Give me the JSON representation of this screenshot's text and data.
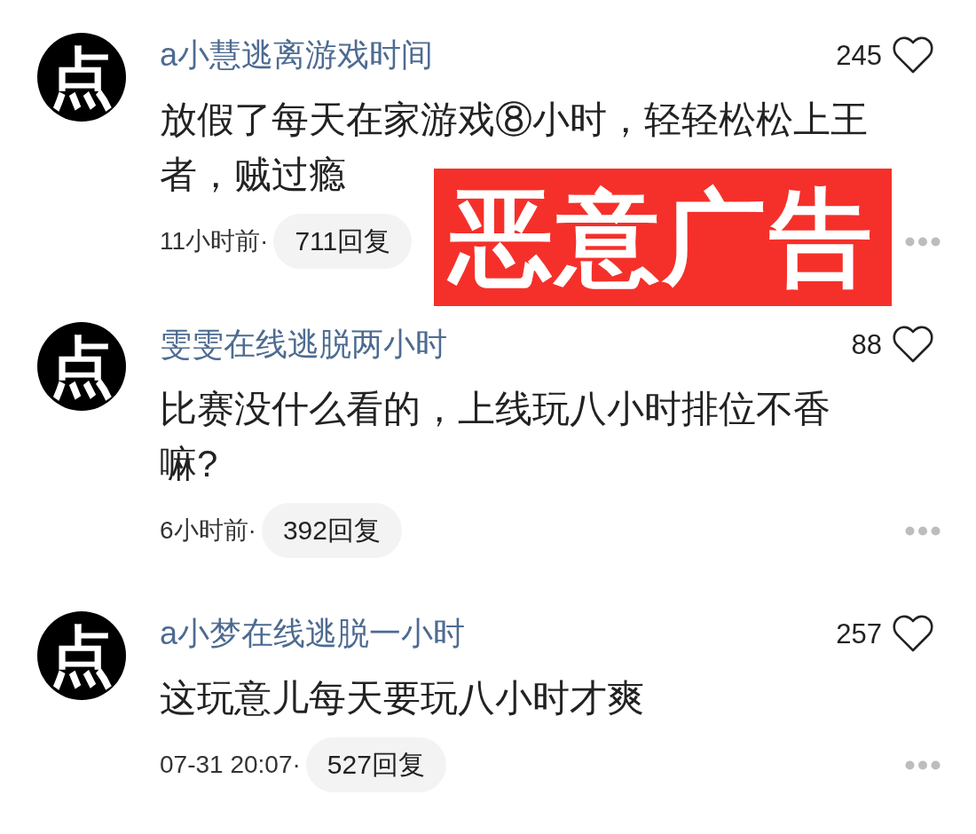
{
  "comments": [
    {
      "avatar": "点",
      "username": "a小慧逃离游戏时间",
      "likes": "245",
      "body": "放假了每天在家游戏⑧小时，轻轻松松上王者，贼过瘾",
      "time": "11小时前·",
      "replies": "711回复"
    },
    {
      "avatar": "点",
      "username": "雯雯在线逃脱两小时",
      "likes": "88",
      "body": "比赛没什么看的，上线玩八小时排位不香嘛?",
      "time": "6小时前·",
      "replies": "392回复"
    },
    {
      "avatar": "点",
      "username": "a小梦在线逃脱一小时",
      "likes": "257",
      "body": "这玩意儿每天要玩八小时才爽",
      "time": "07-31 20:07·",
      "replies": "527回复"
    }
  ],
  "stamp": {
    "text": "恶意广告"
  }
}
